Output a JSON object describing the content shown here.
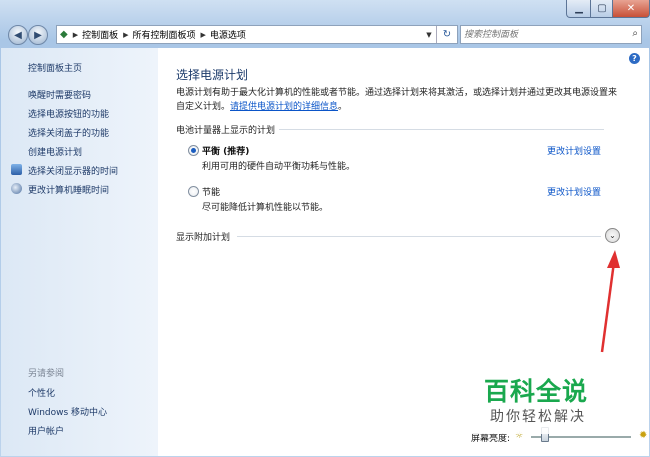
{
  "address": {
    "segments": [
      "控制面板",
      "所有控制面板项",
      "电源选项"
    ]
  },
  "search": {
    "placeholder": "搜索控制面板"
  },
  "sidebar": {
    "items": [
      {
        "label": "控制面板主页"
      },
      {
        "label": "唤醒时需要密码"
      },
      {
        "label": "选择电源按钮的功能"
      },
      {
        "label": "选择关闭盖子的功能"
      },
      {
        "label": "创建电源计划"
      },
      {
        "label": "选择关闭显示器的时间"
      },
      {
        "label": "更改计算机睡眠时间"
      }
    ],
    "see_also": "另请参阅",
    "see_also_items": [
      {
        "label": "个性化"
      },
      {
        "label": "Windows 移动中心"
      },
      {
        "label": "用户帐户"
      }
    ]
  },
  "main": {
    "title": "选择电源计划",
    "desc_1": "电源计划有助于最大化计算机的性能或者节能。通过选择计划来将其激活，或选择计划并通过更改其电源设置来自定义计划。",
    "desc_link": "请提供电源计划的详细信息",
    "group_header": "电池计量器上显示的计划",
    "plans": [
      {
        "name": "平衡 (推荐)",
        "desc": "利用可用的硬件自动平衡功耗与性能。",
        "link": "更改计划设置",
        "selected": true
      },
      {
        "name": "节能",
        "desc": "尽可能降低计算机性能以节能。",
        "link": "更改计划设置",
        "selected": false
      }
    ],
    "additional": "显示附加计划"
  },
  "bottom": {
    "brightness_label": "屏幕亮度:",
    "brightness_level": 0.13
  },
  "watermark": {
    "title": "百科全说",
    "subtitle": "助你轻松解决"
  },
  "colors": {
    "accent": "#0b55c8",
    "arrow": "#e03030",
    "watermark_green": "#1aa84e"
  }
}
